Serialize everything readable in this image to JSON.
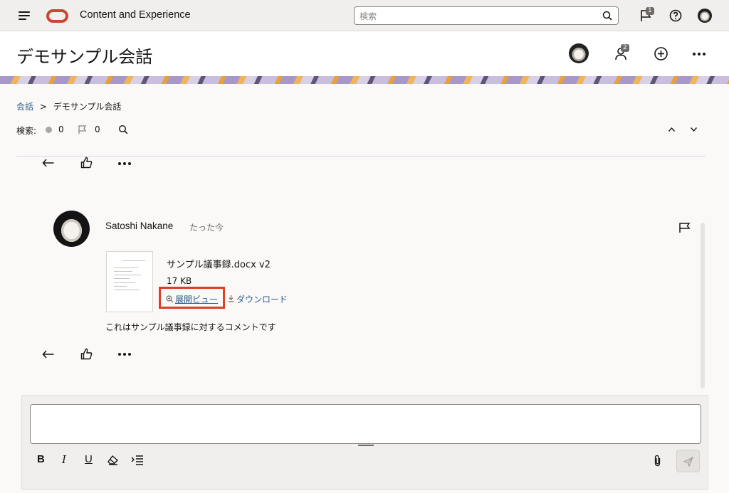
{
  "topbar": {
    "app_title": "Content and Experience",
    "search_placeholder": "検索",
    "notification_count": "1"
  },
  "header": {
    "title": "デモサンプル会話",
    "member_count": "2"
  },
  "breadcrumb": {
    "root": "会話",
    "separator": ">",
    "current": "デモサンプル会話"
  },
  "filter": {
    "label": "検索:",
    "unread_count": "0",
    "flag_count": "0"
  },
  "message": {
    "author": "Satoshi Nakane",
    "time": "たった今",
    "attachment": {
      "name": "サンプル議事録.docx v2",
      "size": "17 KB",
      "preview_label": "展開ビュー",
      "download_label": "ダウンロード"
    },
    "comment": "これはサンプル議事録に対するコメントです"
  },
  "composer": {
    "value": "",
    "bold_label": "B",
    "italic_label": "I",
    "underline_label": "U"
  },
  "colors": {
    "accent": "#c74634",
    "link": "#2c5d8a",
    "highlight": "#e03d25"
  }
}
